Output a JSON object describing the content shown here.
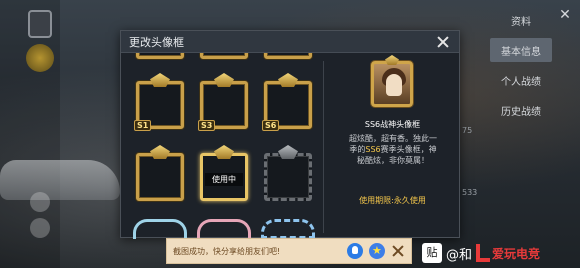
{
  "background": {
    "side_menu": [
      "资料",
      "基本信息",
      "个人战绩",
      "历史战绩"
    ],
    "numbers": [
      "75",
      "533"
    ]
  },
  "dialog": {
    "title": "更改头像框",
    "frames": [
      {
        "tag": "S1"
      },
      {
        "tag": "S3"
      },
      {
        "tag": "S6"
      },
      {
        "tag": ""
      },
      {
        "tag": "",
        "status": "使用中"
      },
      {
        "tag": ""
      }
    ],
    "detail": {
      "name": "SS6战神头像框",
      "description_prefix": "超炫酷，超有香。独此一季的",
      "description_highlight": "SS6",
      "description_suffix": "赛季头像框，神秘酷炫，非你莫属！",
      "usage": "使用期限:永久使用"
    }
  },
  "toast": {
    "text": "截图成功，快分享给朋友们吧!"
  },
  "watermark": {
    "badge": "贴",
    "text": "@和",
    "brand": "爱玩电竞"
  },
  "colors": {
    "gold": "#c9a04a",
    "highlight": "#f3c64b",
    "dialog_bg": "#1d2229",
    "toast_bg": "#f0ddc0"
  }
}
